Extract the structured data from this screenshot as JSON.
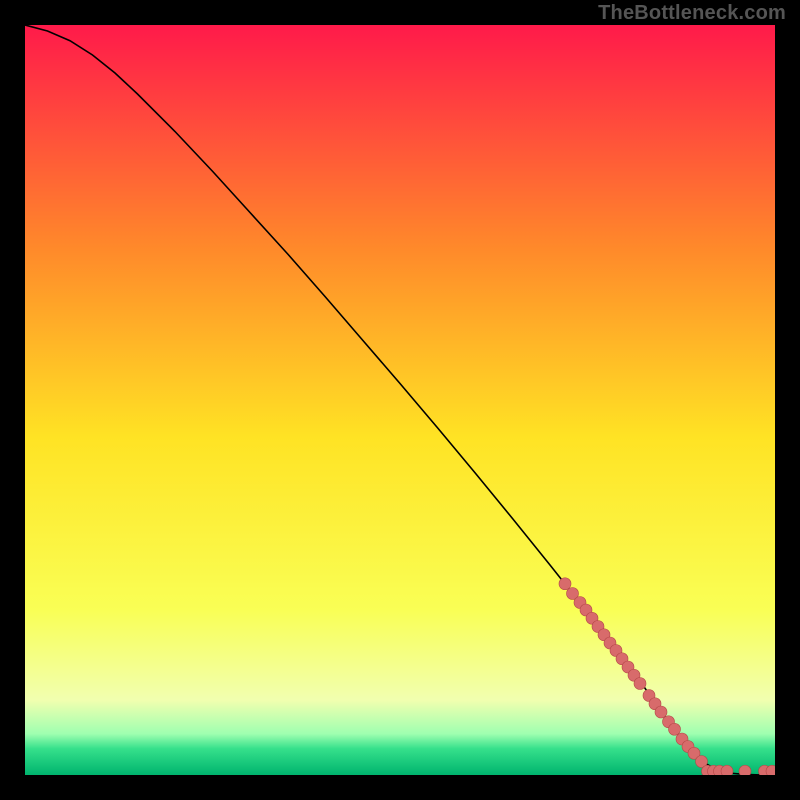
{
  "watermark": "TheBottleneck.com",
  "colors": {
    "gradient_top": "#ff1a4a",
    "gradient_upper_mid": "#ff8a2a",
    "gradient_mid": "#ffe324",
    "gradient_lower_mid": "#f9ff55",
    "gradient_light": "#f1ffaf",
    "gradient_green1": "#9fffb0",
    "gradient_green2": "#35e08b",
    "gradient_bottom": "#00b46e",
    "curve": "#000000",
    "marker_fill": "#d86b6b",
    "marker_stroke": "#b44747"
  },
  "chart_data": {
    "type": "line",
    "title": "",
    "xlabel": "",
    "ylabel": "",
    "xlim": [
      0,
      100
    ],
    "ylim": [
      0,
      100
    ],
    "curve": {
      "x": [
        0,
        3,
        6,
        9,
        12,
        15,
        20,
        25,
        30,
        35,
        40,
        45,
        50,
        55,
        60,
        65,
        70,
        75,
        80,
        82,
        85,
        88,
        90,
        92,
        94,
        96,
        98,
        100
      ],
      "y": [
        100,
        99.2,
        97.9,
        96.0,
        93.6,
        90.8,
        85.8,
        80.5,
        75.0,
        69.5,
        63.8,
        58.0,
        52.2,
        46.3,
        40.3,
        34.2,
        28.0,
        21.7,
        15.2,
        12.5,
        8.3,
        4.2,
        2.0,
        0.8,
        0.25,
        0.07,
        0.01,
        0.0
      ]
    },
    "markers": [
      {
        "x": 72.0,
        "y": 25.5
      },
      {
        "x": 73.0,
        "y": 24.2
      },
      {
        "x": 74.0,
        "y": 23.0
      },
      {
        "x": 74.8,
        "y": 22.0
      },
      {
        "x": 75.6,
        "y": 20.9
      },
      {
        "x": 76.4,
        "y": 19.8
      },
      {
        "x": 77.2,
        "y": 18.7
      },
      {
        "x": 78.0,
        "y": 17.6
      },
      {
        "x": 78.8,
        "y": 16.6
      },
      {
        "x": 79.6,
        "y": 15.5
      },
      {
        "x": 80.4,
        "y": 14.4
      },
      {
        "x": 81.2,
        "y": 13.3
      },
      {
        "x": 82.0,
        "y": 12.2
      },
      {
        "x": 83.2,
        "y": 10.6
      },
      {
        "x": 84.0,
        "y": 9.5
      },
      {
        "x": 84.8,
        "y": 8.4
      },
      {
        "x": 85.8,
        "y": 7.1
      },
      {
        "x": 86.6,
        "y": 6.1
      },
      {
        "x": 87.6,
        "y": 4.8
      },
      {
        "x": 88.4,
        "y": 3.8
      },
      {
        "x": 89.2,
        "y": 2.9
      },
      {
        "x": 90.2,
        "y": 1.8
      },
      {
        "x": 91.0,
        "y": 0.5
      },
      {
        "x": 91.8,
        "y": 0.5
      },
      {
        "x": 92.6,
        "y": 0.5
      },
      {
        "x": 93.6,
        "y": 0.5
      },
      {
        "x": 96.0,
        "y": 0.5
      },
      {
        "x": 98.6,
        "y": 0.5
      },
      {
        "x": 99.6,
        "y": 0.5
      }
    ],
    "marker_radius": 6
  }
}
